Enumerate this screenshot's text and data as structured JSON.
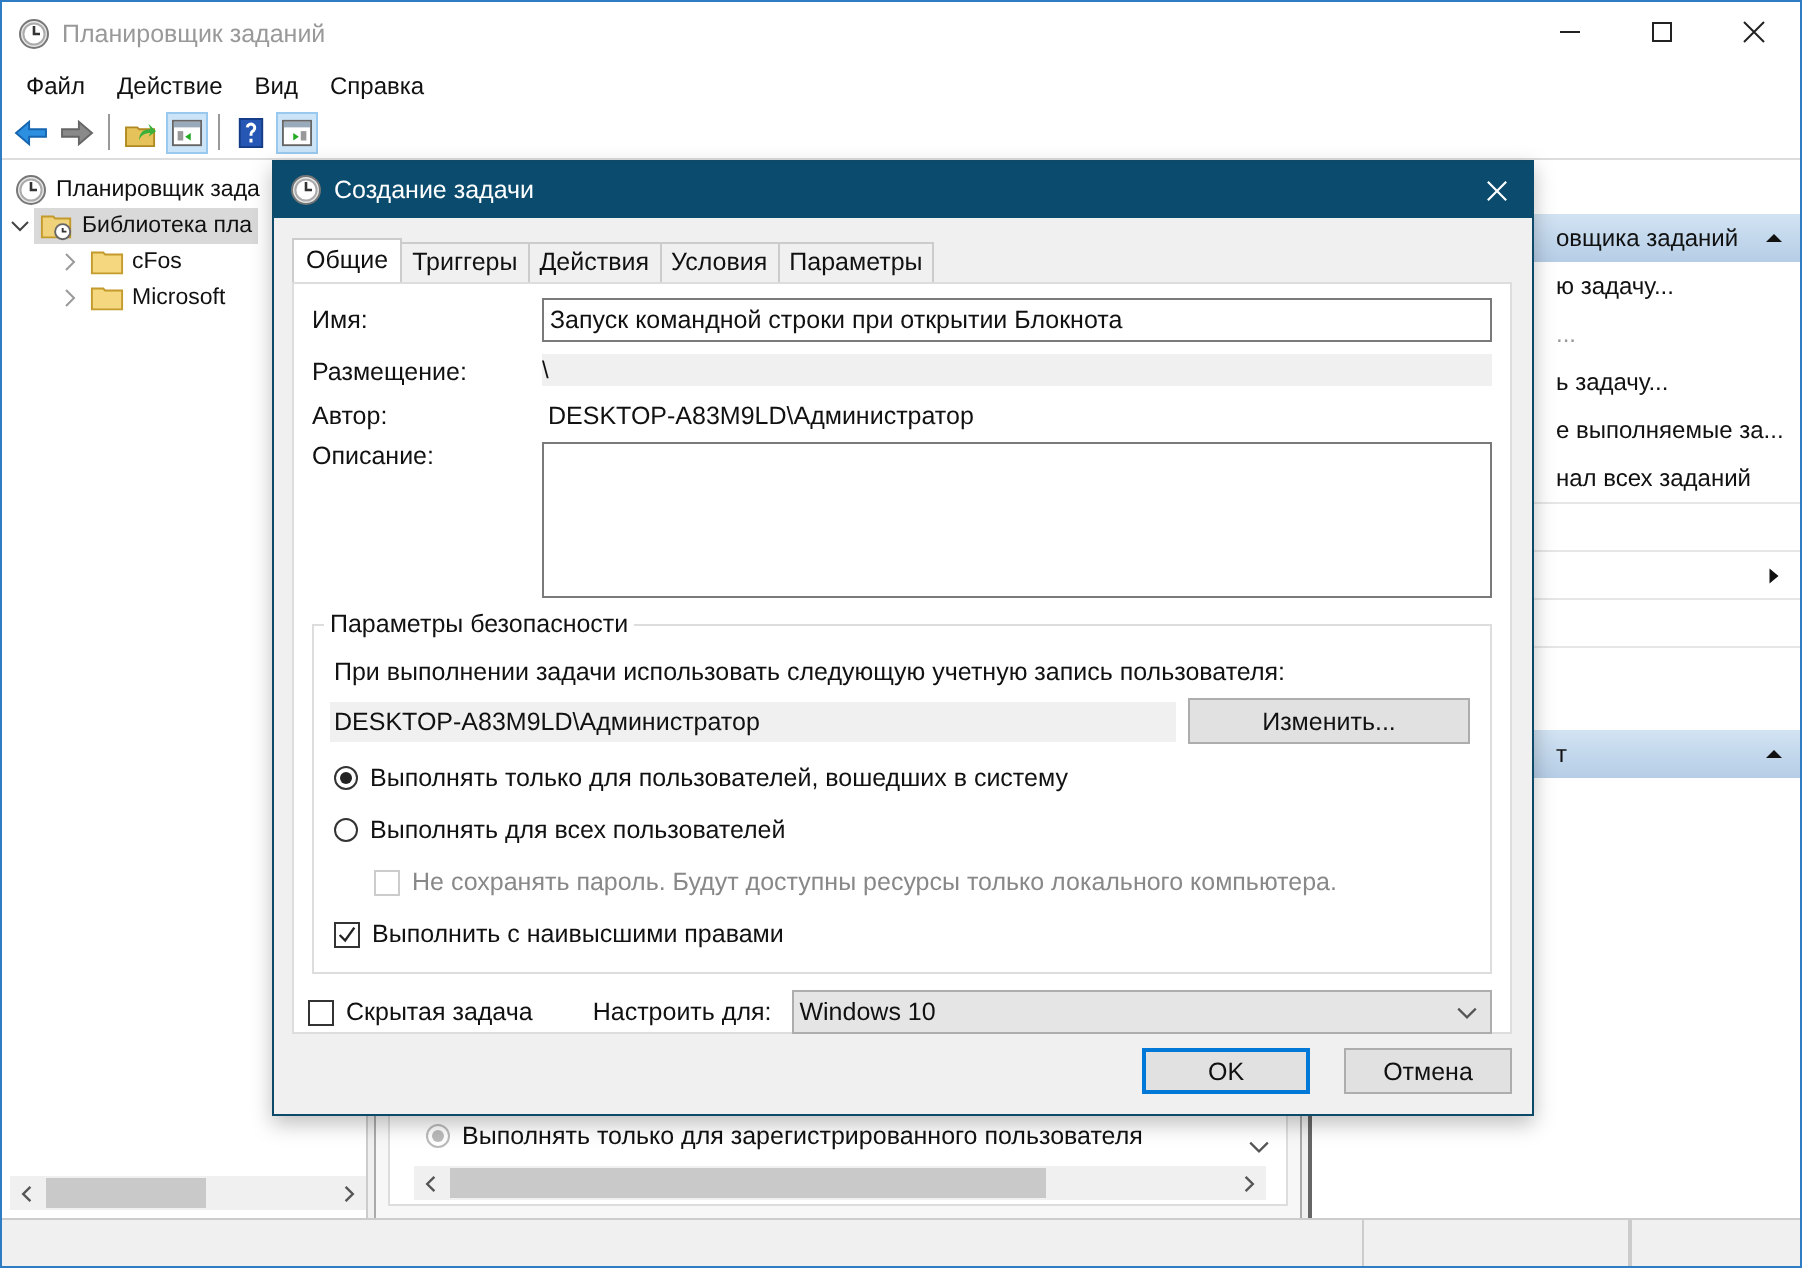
{
  "window": {
    "title": "Планировщик заданий"
  },
  "menu": [
    {
      "label": "Файл"
    },
    {
      "label": "Действие"
    },
    {
      "label": "Вид"
    },
    {
      "label": "Справка"
    }
  ],
  "toolbar": [
    [
      {
        "kind": "back",
        "selected": false
      },
      {
        "kind": "forward",
        "selected": false
      }
    ],
    [
      {
        "kind": "up",
        "selected": false
      },
      {
        "kind": "console",
        "selected": true
      }
    ],
    [
      {
        "kind": "help",
        "selected": false
      },
      {
        "kind": "actions",
        "selected": true
      }
    ]
  ],
  "tree": [
    {
      "label": "Планировщик зада",
      "kind": "scheduler",
      "selected": false,
      "children": [
        {
          "label": "Библиотека пла",
          "kind": "library",
          "selected": true,
          "expanded": true,
          "children": [
            {
              "label": "cFos",
              "kind": "folder",
              "selected": false,
              "expanded": false
            },
            {
              "label": "Microsoft",
              "kind": "folder",
              "selected": false,
              "expanded": false
            }
          ]
        }
      ]
    }
  ],
  "center": {
    "option": {
      "label": "Выполнять только для зарегистрированного пользователя",
      "selected": true,
      "disabled": true
    }
  },
  "actions": [
    {
      "title": "овщика заданий",
      "expanded": true,
      "items": [
        {
          "kind": "link",
          "label": "ю задачу..."
        },
        {
          "kind": "muted",
          "label": "..."
        },
        {
          "kind": "link",
          "label": "ь задачу..."
        },
        {
          "kind": "link",
          "label": "е выполняемые за..."
        },
        {
          "kind": "link",
          "label": "нал всех заданий"
        },
        {
          "kind": "blank"
        },
        {
          "kind": "submenu"
        },
        {
          "kind": "blank"
        },
        {
          "kind": "blank"
        }
      ]
    },
    {
      "title": "т",
      "expanded": true
    }
  ],
  "dialog": {
    "title": "Создание задачи",
    "tabs": [
      {
        "label": "Общие",
        "selected": true
      },
      {
        "label": "Триггеры",
        "selected": false
      },
      {
        "label": "Действия",
        "selected": false
      },
      {
        "label": "Условия",
        "selected": false
      },
      {
        "label": "Параметры",
        "selected": false
      }
    ],
    "name": {
      "label": "Имя:",
      "value": "Запуск командной строки при открытии Блокнота"
    },
    "location": {
      "label": "Размещение:",
      "value": "\\"
    },
    "author": {
      "label": "Автор:",
      "value": "DESKTOP-A83M9LD\\Администратор"
    },
    "description": {
      "label": "Описание:"
    },
    "security": {
      "title": "Параметры безопасности",
      "prompt": "При выполнении задачи использовать следующую учетную запись пользователя:",
      "account": "DESKTOP-A83M9LD\\Администратор",
      "change_button": "Изменить...",
      "options": [
        {
          "kind": "radio",
          "label": "Выполнять только для пользователей, вошедших в систему",
          "selected": true,
          "disabled": false
        },
        {
          "kind": "radio",
          "label": "Выполнять для всех пользователей",
          "selected": false,
          "disabled": false,
          "children": [
            {
              "kind": "checkbox",
              "label": "Не сохранять пароль. Будут доступны ресурсы только локального компьютера.",
              "checked": false,
              "disabled": true
            }
          ]
        },
        {
          "kind": "checkbox",
          "label": "Выполнить с наивысшими правами",
          "checked": true,
          "disabled": false
        }
      ]
    },
    "hidden_task": {
      "label": "Скрытая задача",
      "checked": false
    },
    "configure": {
      "label": "Настроить для:",
      "value": "Windows 10"
    },
    "buttons": [
      {
        "label": "OK",
        "default": true
      },
      {
        "label": "Отмена",
        "default": false
      }
    ]
  }
}
